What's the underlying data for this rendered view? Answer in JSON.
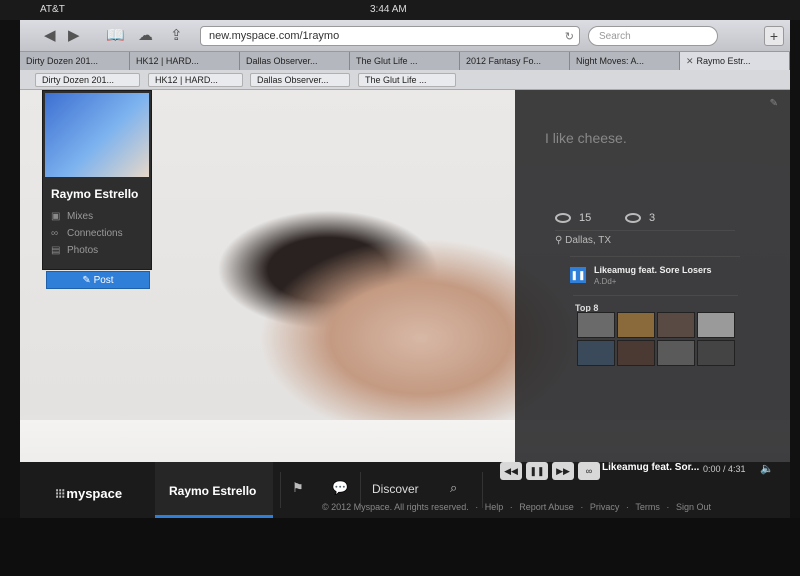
{
  "status_bar": {
    "time": "3:44 AM",
    "carrier": "AT&T"
  },
  "browser": {
    "url": "new.myspace.com/1raymo",
    "search_placeholder": "Search",
    "tabs": [
      {
        "label": "Dirty Dozen 201..."
      },
      {
        "label": "HK12 | HARD..."
      },
      {
        "label": "Dallas Observer..."
      },
      {
        "label": "The Glut Life ..."
      },
      {
        "label": "2012 Fantasy Fo..."
      },
      {
        "label": "Night Moves: A..."
      },
      {
        "label": "Raymo Estr..."
      }
    ]
  },
  "profile": {
    "name": "Raymo Estrello",
    "links": [
      "Mixes",
      "Connections",
      "Photos"
    ],
    "post_label": "Post"
  },
  "info": {
    "tagline": "I like cheese.",
    "connections_count": "15",
    "mutual_count": "3",
    "location": "Dallas, TX",
    "track_title": "Likeamug feat. Sore Losers",
    "track_artist": "A.Dd+",
    "top8_label": "Top 8"
  },
  "navbar": {
    "logo": "myspace",
    "user": "Raymo Estrello",
    "discover": "Discover",
    "now_playing": "Likeamug feat. Sor...",
    "time": "0:00 / 4:31",
    "footer": {
      "copyright": "© 2012 Myspace. All rights reserved.",
      "links": [
        "Help",
        "Report Abuse",
        "Privacy",
        "Terms",
        "Sign Out"
      ]
    }
  },
  "colors": {
    "accent": "#2f7ed8",
    "panel": "#262628",
    "navbar": "#1b1b1b"
  }
}
